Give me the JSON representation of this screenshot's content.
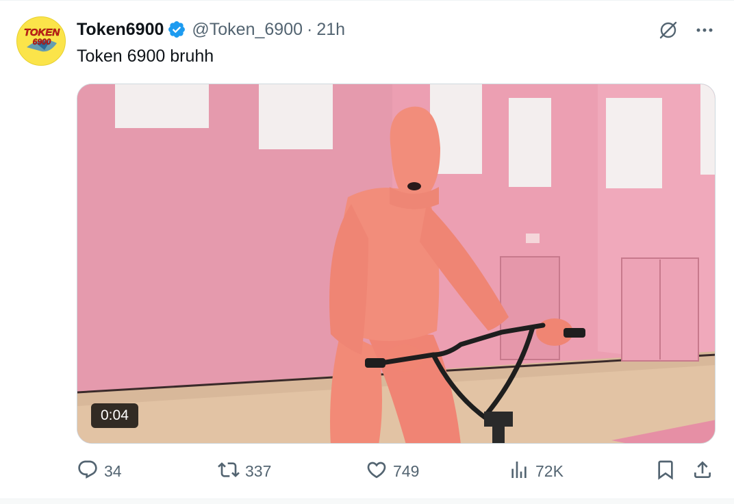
{
  "tweet": {
    "display_name": "Token6900",
    "handle": "@Token_6900",
    "separator": "·",
    "time": "21h",
    "text": "Token 6900 bruhh",
    "verified": true,
    "avatar": {
      "logo_text": "TOKEN 6900",
      "background": "#fbe44a"
    }
  },
  "media": {
    "type": "video",
    "duration": "0:04",
    "description_icon": "video-thumbnail"
  },
  "actions": {
    "replies": {
      "icon": "reply-icon",
      "count": "34"
    },
    "reposts": {
      "icon": "repost-icon",
      "count": "337"
    },
    "likes": {
      "icon": "heart-icon",
      "count": "749"
    },
    "views": {
      "icon": "views-icon",
      "count": "72K"
    },
    "bookmark": {
      "icon": "bookmark-icon"
    },
    "share": {
      "icon": "share-icon"
    }
  },
  "header_actions": {
    "grok": {
      "icon": "grok-icon"
    },
    "more": {
      "icon": "more-icon"
    }
  },
  "colors": {
    "verified_blue": "#1d9bf0",
    "secondary_text": "#536471",
    "primary_text": "#0f1419"
  }
}
